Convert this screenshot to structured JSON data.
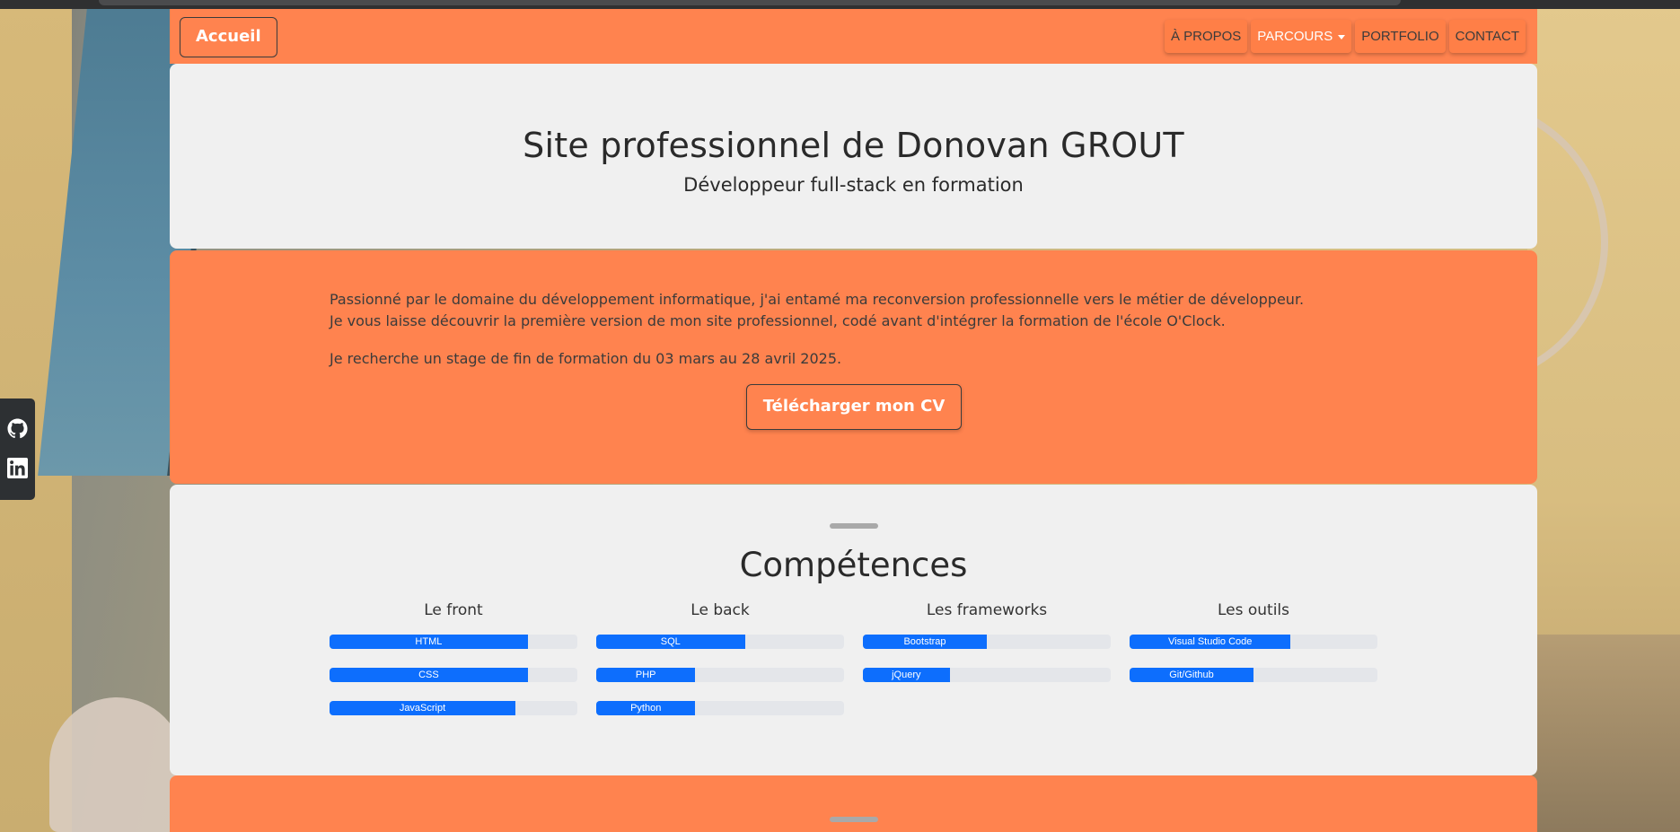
{
  "navbar": {
    "brand": "Accueil",
    "links": [
      {
        "label": "À PROPOS"
      },
      {
        "label": "PARCOURS"
      },
      {
        "label": "PORTFOLIO"
      },
      {
        "label": "CONTACT"
      }
    ]
  },
  "hero": {
    "title": "Site professionnel de Donovan GROUT",
    "subtitle": "Développeur full-stack en formation"
  },
  "intro": {
    "line1": "Passionné par le domaine du développement informatique, j'ai entamé ma reconversion professionnelle vers le métier de développeur.",
    "line2": "Je vous laisse découvrir la première version de mon site professionnel, codé avant d'intégrer la formation de l'école O'Clock.",
    "line3": "Je recherche un stage de fin de formation du 03 mars au 28 avril 2025.",
    "cv_button": "Télécharger mon CV"
  },
  "skills": {
    "title": "Compétences",
    "columns": [
      {
        "title": "Le front",
        "items": [
          {
            "name": "HTML",
            "level": 0.8
          },
          {
            "name": "CSS",
            "level": 0.8
          },
          {
            "name": "JavaScript",
            "level": 0.75
          }
        ]
      },
      {
        "title": "Le back",
        "items": [
          {
            "name": "SQL",
            "level": 0.6
          },
          {
            "name": "PHP",
            "level": 0.4
          },
          {
            "name": "Python",
            "level": 0.4
          }
        ]
      },
      {
        "title": "Les frameworks",
        "items": [
          {
            "name": "Bootstrap",
            "level": 0.5
          },
          {
            "name": "jQuery",
            "level": 0.35
          }
        ]
      },
      {
        "title": "Les outils",
        "items": [
          {
            "name": "Visual Studio Code",
            "level": 0.65
          },
          {
            "name": "Git/Github",
            "level": 0.5
          }
        ]
      }
    ]
  },
  "social": {
    "icons": [
      "github-icon",
      "linkedin-icon"
    ]
  },
  "colors": {
    "accent": "#ff834f",
    "panel": "#f0f0f0",
    "progress": "#0d6efd"
  }
}
